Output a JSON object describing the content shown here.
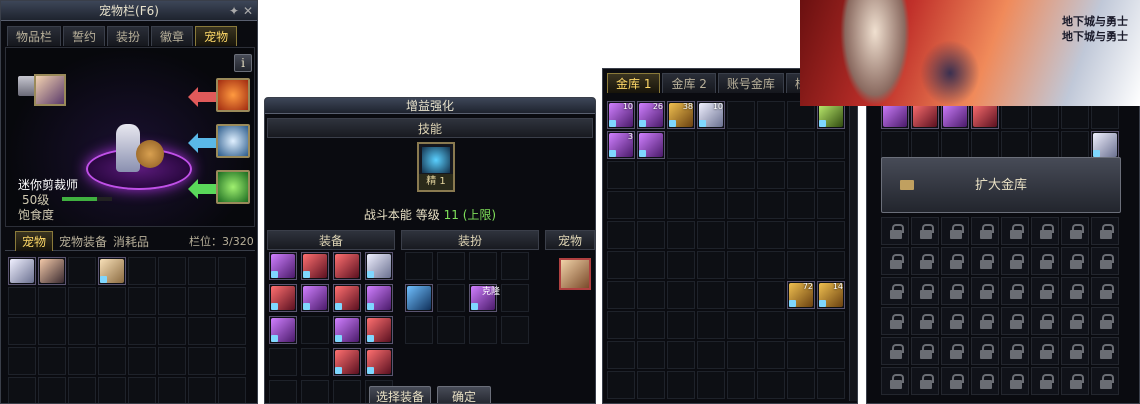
{
  "pet_window": {
    "title": "宠物栏(F6)",
    "tabs": [
      "物品栏",
      "誓约",
      "装扮",
      "徽章",
      "宠物"
    ],
    "info_button": "i",
    "pet_name": "迷你剪裁师",
    "pet_level": "50级",
    "satiety_label": "饱食度",
    "satiety_fraction": 0.7,
    "sub_tabs": [
      "宠物",
      "宠物装备",
      "消耗品"
    ],
    "slot_label": "栏位：3/320"
  },
  "buff_window": {
    "title": "增益强化",
    "skill_header": "技能",
    "skill_badge": "精",
    "skill_badge_num": "1",
    "skill_line": "战斗本能 等级",
    "skill_level": "11",
    "skill_limit": "(上限)",
    "col_equipment": "装备",
    "col_avatar": "装扮",
    "col_pet": "宠物",
    "avatar_item_text": "克隆",
    "select_button": "选择装备",
    "confirm_button": "确定"
  },
  "storage_window": {
    "tabs": [
      "金库 1",
      "金库 2",
      "账号金库",
      "栏"
    ],
    "counts": [
      "10",
      "26",
      "38",
      "10",
      "3",
      "72",
      "14"
    ]
  },
  "storage2_window": {
    "expand_button": "扩大金库"
  },
  "banner": {
    "logo_lines": [
      "地下城与勇士",
      "地下城与勇士"
    ]
  },
  "colors": {
    "accent_gold": "#ffd968",
    "skill_green": "#7fe05a",
    "panel_bg": "#0a0b10"
  }
}
